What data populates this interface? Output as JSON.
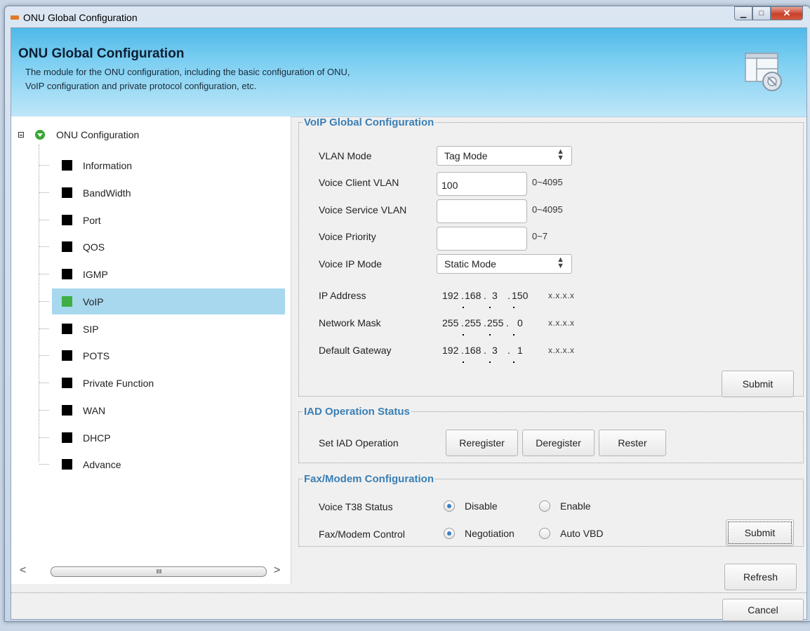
{
  "window": {
    "title": "ONU Global Configuration",
    "controls": {
      "minimize": "▁",
      "maximize": "□",
      "close": "✕"
    }
  },
  "banner": {
    "title": "ONU Global Configuration",
    "desc_line1": "The module for the ONU configuration, including the basic configuration of ONU,",
    "desc_line2": "VoIP configuration and private protocol configuration, etc."
  },
  "tree": {
    "root": "ONU Configuration",
    "items": [
      {
        "label": "Information"
      },
      {
        "label": "BandWidth"
      },
      {
        "label": "Port"
      },
      {
        "label": "QOS"
      },
      {
        "label": "IGMP"
      },
      {
        "label": "VoIP",
        "selected": true
      },
      {
        "label": "SIP"
      },
      {
        "label": "POTS"
      },
      {
        "label": "Private Function"
      },
      {
        "label": "WAN"
      },
      {
        "label": "DHCP"
      },
      {
        "label": "Advance"
      }
    ],
    "scroll": {
      "left": "<",
      "right": ">",
      "grip": "IIIIII"
    }
  },
  "voip": {
    "legend": "VoIP Global Configuration",
    "vlan_mode_label": "VLAN Mode",
    "vlan_mode_value": "Tag Mode",
    "client_vlan_label": "Voice Client VLAN",
    "client_vlan_value": "100",
    "client_vlan_range": "0~4095",
    "service_vlan_label": "Voice Service VLAN",
    "service_vlan_value": "",
    "service_vlan_range": "0~4095",
    "priority_label": "Voice Priority",
    "priority_value": "",
    "priority_range": "0~7",
    "ip_mode_label": "Voice IP Mode",
    "ip_mode_value": "Static Mode",
    "ip_label": "IP Address",
    "ip": [
      "192",
      "168",
      "3",
      "150"
    ],
    "mask_label": "Network Mask",
    "mask": [
      "255",
      "255",
      "255",
      "0"
    ],
    "gw_label": "Default Gateway",
    "gw": [
      "192",
      "168",
      "3",
      "1"
    ],
    "format_hint": "x.x.x.x",
    "submit": "Submit"
  },
  "iad": {
    "legend": "IAD Operation Status",
    "label": "Set IAD Operation",
    "reregister": "Reregister",
    "deregister": "Deregister",
    "rester": "Rester"
  },
  "fax": {
    "legend": "Fax/Modem Configuration",
    "t38_label": "Voice T38 Status",
    "t38_disable": "Disable",
    "t38_enable": "Enable",
    "t38_selected": "Disable",
    "ctrl_label": "Fax/Modem Control",
    "ctrl_negotiation": "Negotiation",
    "ctrl_autovbd": "Auto VBD",
    "ctrl_selected": "Negotiation",
    "submit": "Submit"
  },
  "actions": {
    "refresh": "Refresh",
    "cancel": "Cancel"
  },
  "colors": {
    "accent": "#3a7fb5",
    "selected_row": "#a7d8ee",
    "active_square": "#3fae44"
  }
}
